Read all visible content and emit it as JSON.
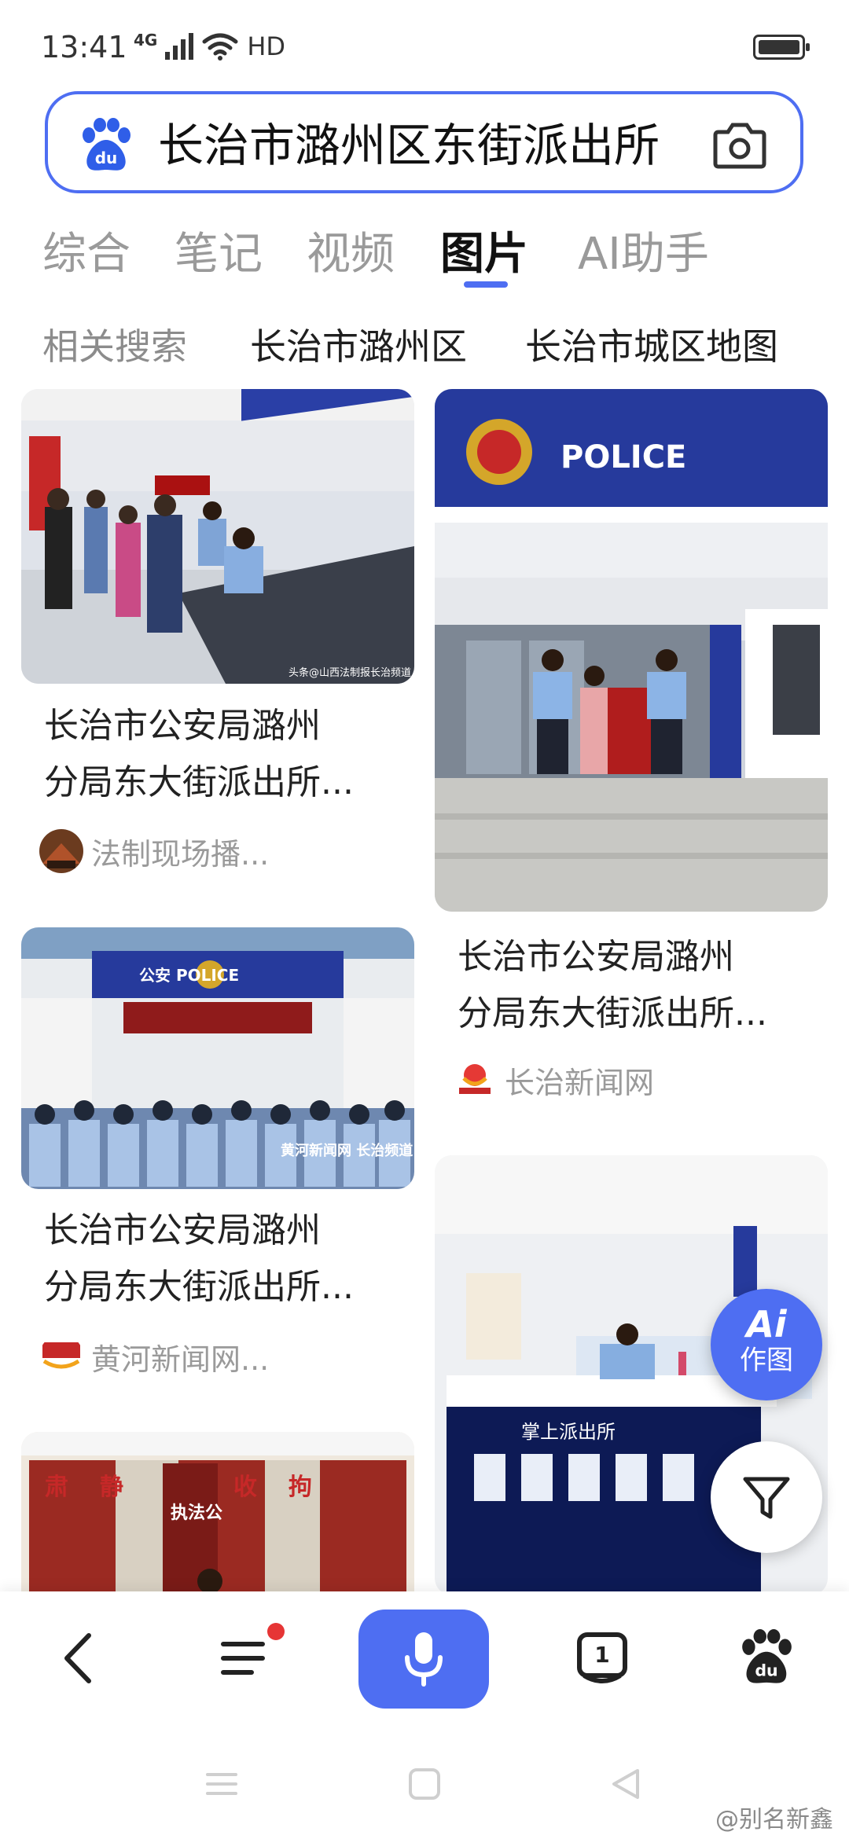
{
  "status_bar": {
    "time": "13:41",
    "network": "4G",
    "hd": "HD"
  },
  "search": {
    "query": "长治市潞州区东街派出所"
  },
  "tabs": [
    {
      "label": "综合",
      "active": false
    },
    {
      "label": "笔记",
      "active": false
    },
    {
      "label": "视频",
      "active": false
    },
    {
      "label": "图片",
      "active": true
    },
    {
      "label": "AI助手",
      "active": false
    }
  ],
  "related": {
    "label": "相关搜索",
    "chips": [
      "长治市潞州区",
      "长治市城区地图"
    ]
  },
  "cards": [
    {
      "title_line1": "长治市公安局潞州",
      "title_line2": "分局东大街派出所...",
      "source": "法制现场播...",
      "image_caption": "头条@山西法制报长治频道"
    },
    {
      "title_line1": "长治市公安局潞州",
      "title_line2": "分局东大街派出所...",
      "source": "长治新闻网",
      "image_sign": "POLICE"
    },
    {
      "title_line1": "长治市公安局潞州",
      "title_line2": "分局东大街派出所...",
      "source": "黄河新闻网...",
      "image_sign": "公安 POLICE",
      "image_watermark": "黄河新闻网 长治频道"
    },
    {
      "image_sign": "掌上派出所"
    },
    {
      "image_text": [
        "肃",
        "静",
        "收",
        "拘",
        "执法公"
      ]
    }
  ],
  "fab": {
    "ai_mark": "Ai",
    "ai_text": "作图",
    "filter": "filter-icon"
  },
  "toolbar": {
    "items": [
      "back-icon",
      "menu-icon",
      "microphone-icon",
      "tabs-icon",
      "baidu-home-icon"
    ],
    "tab_count": "1"
  },
  "watermark": "@别名新鑫",
  "colors": {
    "accent": "#4e6ef2",
    "badge": "#e63535",
    "police_blue": "#263a9c"
  }
}
